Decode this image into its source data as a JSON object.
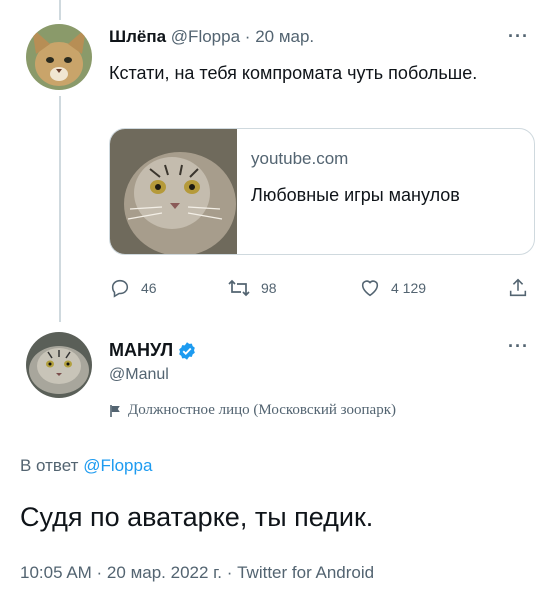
{
  "tweet1": {
    "display_name": "Шлёпа",
    "handle": "@Floppa",
    "separator": "·",
    "date": "20 мар.",
    "more_icon": "more-dots-icon",
    "text": "Кстати, на тебя компромата чуть побольше.",
    "card": {
      "domain": "youtube.com",
      "title": "Любовные игры манулов"
    },
    "actions": {
      "reply_count": "46",
      "retweet_count": "98",
      "like_count": "4 129"
    }
  },
  "tweet2": {
    "display_name": "МАНУЛ",
    "verified_icon": "verified-badge-icon",
    "handle": "@Manul",
    "label": "Должностное лицо (Московский зоопарк)",
    "reply_prefix": "В ответ",
    "reply_handle": "@Floppa",
    "text": "Судя по аватарке, ты педик.",
    "meta": "10:05 AM · 20 мар. 2022 г. · Twitter for Android"
  },
  "colors": {
    "accent": "#1d9bf0",
    "muted": "#536471",
    "border": "#cfd9de",
    "text": "#0f1419"
  }
}
